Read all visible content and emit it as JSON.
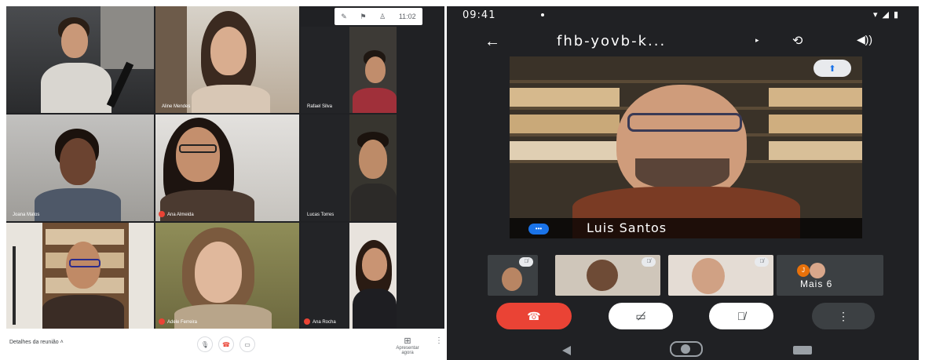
{
  "desktop": {
    "toolbar": {
      "icons": [
        "pencil-icon",
        "flag-icon",
        "person-icon"
      ],
      "time": "11:02"
    },
    "participants": [
      {
        "name": "",
        "muted": false
      },
      {
        "name": "Aline Mendes",
        "muted": false
      },
      {
        "name": "Rafael Silva",
        "muted": false
      },
      {
        "name": "Joana Matos",
        "muted": false
      },
      {
        "name": "Ana Almeida",
        "muted": true
      },
      {
        "name": "Lucas Torres",
        "muted": false
      },
      {
        "name": "",
        "muted": false
      },
      {
        "name": "Adele Ferreira",
        "muted": true
      },
      {
        "name": "Ana Rocha",
        "muted": true
      }
    ],
    "bottom": {
      "details_label": "Detalhes da reunião",
      "present_label": "Apresentar agora"
    }
  },
  "phone": {
    "status_time": "09:41",
    "meeting_code": "fhb-yovb-k...",
    "speaker_name": "Luis Santos",
    "more_label": "Mais 6",
    "more_avatar_initial": "J",
    "colors": {
      "end_call": "#ea4335",
      "accent": "#1a73e8",
      "background": "#202124"
    }
  }
}
